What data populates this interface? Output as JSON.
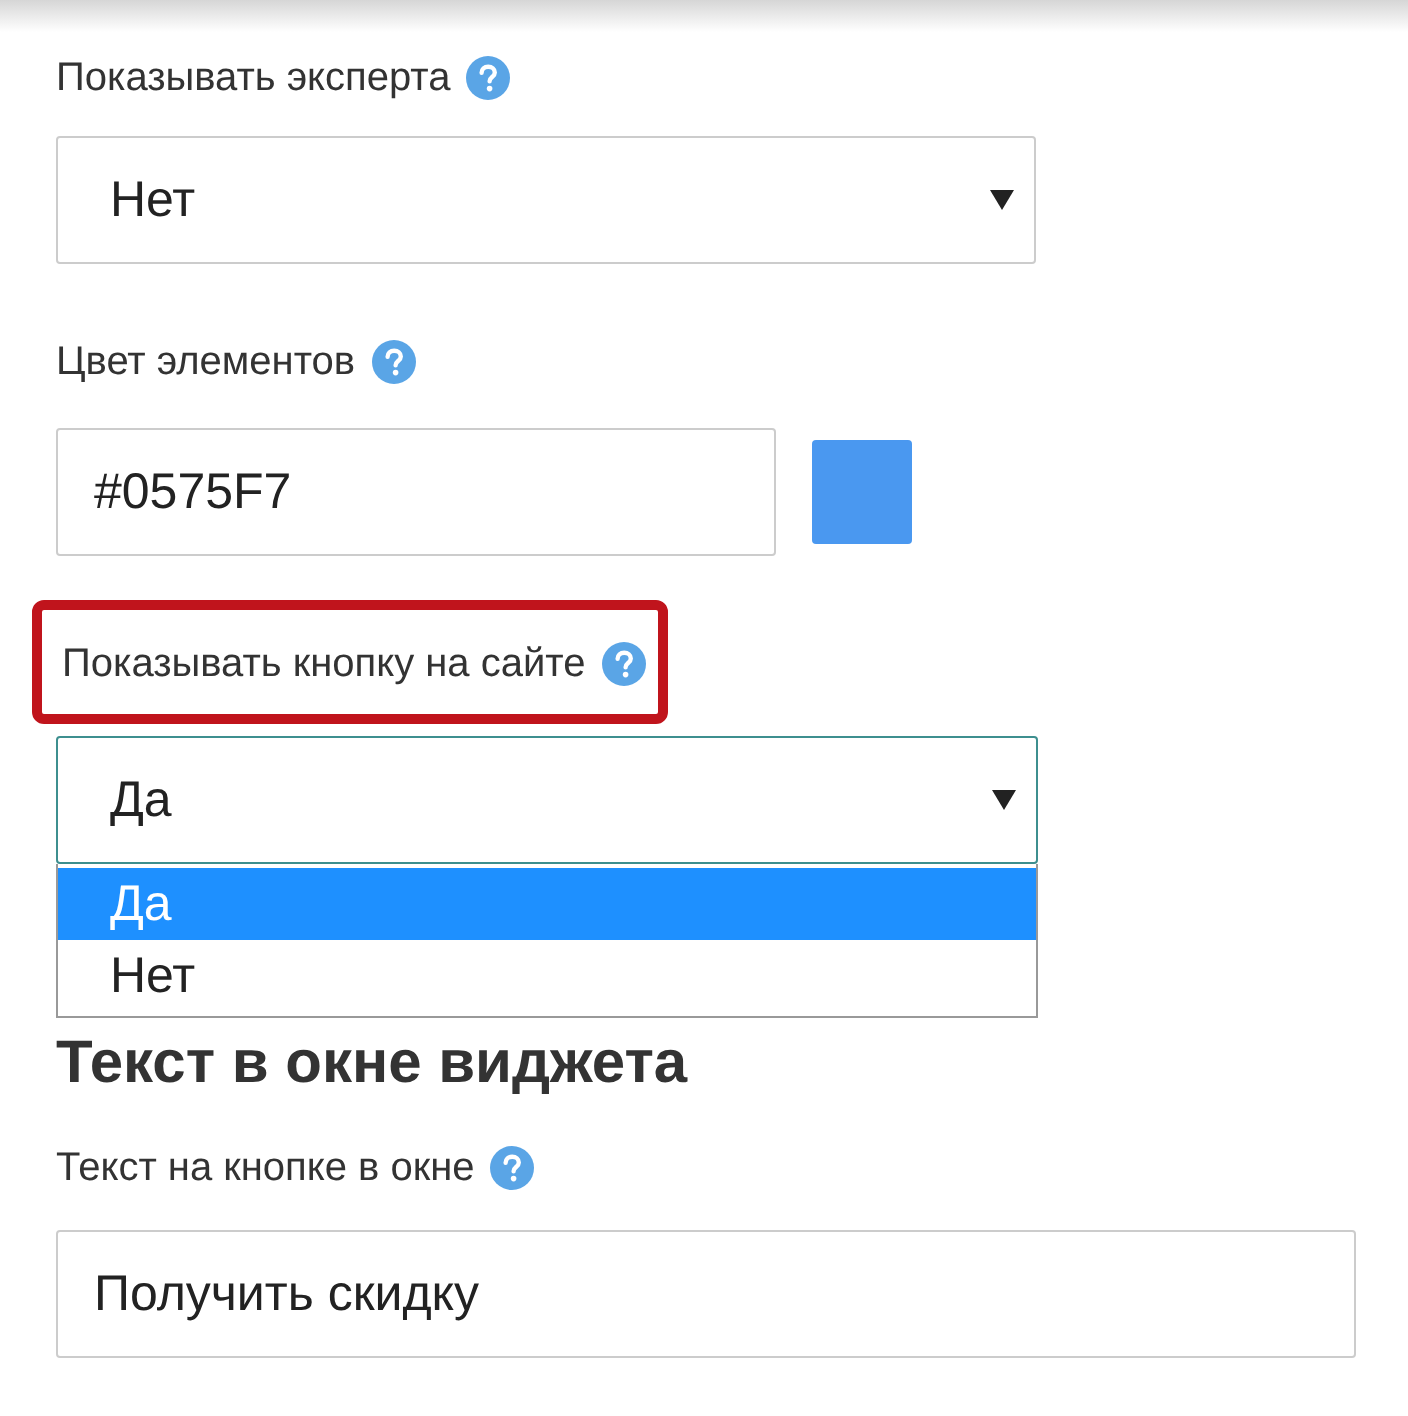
{
  "expert_field": {
    "label": "Показывать эксперта",
    "value": "Нет"
  },
  "color_field": {
    "label": "Цвет элементов",
    "value": "#0575F7",
    "color": "#4a98f0"
  },
  "button_field": {
    "label": "Показывать кнопку на сайте",
    "highlighted": true,
    "value": "Да",
    "expanded": true,
    "options": [
      {
        "label": "Да",
        "selected": true
      },
      {
        "label": "Нет",
        "selected": false
      }
    ]
  },
  "section_title": "Текст в окне виджета",
  "button_text_field": {
    "label": "Текст на кнопке в окне",
    "value": "Получить скидку"
  }
}
